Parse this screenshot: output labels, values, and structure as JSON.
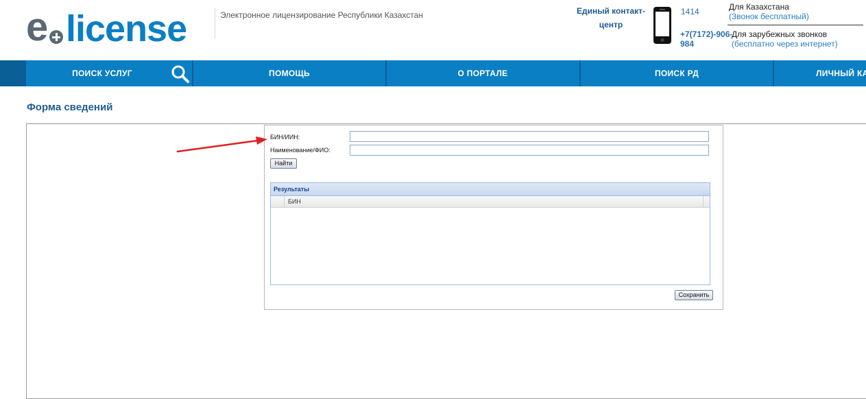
{
  "header": {
    "logo_text": "e+license",
    "tagline": "Электронное лицензирование Республики Казахстан",
    "contact_title": "Единый контакт-центр",
    "phone_local": "1414",
    "phone_intl": "+7(7172)-906-984",
    "kz_label": "Для Казахстана",
    "kz_sub": "(Звонок бесплатный)",
    "intl_label": "Для зарубежных звонков",
    "intl_sub": "(бесплатно через интернет)"
  },
  "nav": {
    "items": [
      "ПОИСК УСЛУГ",
      "ПОМОЩЬ",
      "О ПОРТАЛЕ",
      "ПОИСК РД",
      "ЛИЧНЫЙ КАБИНЕТ"
    ],
    "search_icon": "search-icon"
  },
  "page": {
    "title": "Форма сведений"
  },
  "form": {
    "bin_label": "БИН/ИИН:",
    "bin_value": "",
    "name_label": "Наименование/ФИО:",
    "name_value": "",
    "find_button": "Найти",
    "results_title": "Результаты",
    "results_columns": [
      "БИН"
    ],
    "results_rows": [],
    "save_button": "Сохранить"
  },
  "colors": {
    "nav_bg": "#0b7fc4",
    "nav_separator": "#0a5f96",
    "title": "#1f5c92",
    "annotation_arrow": "#e02020"
  }
}
